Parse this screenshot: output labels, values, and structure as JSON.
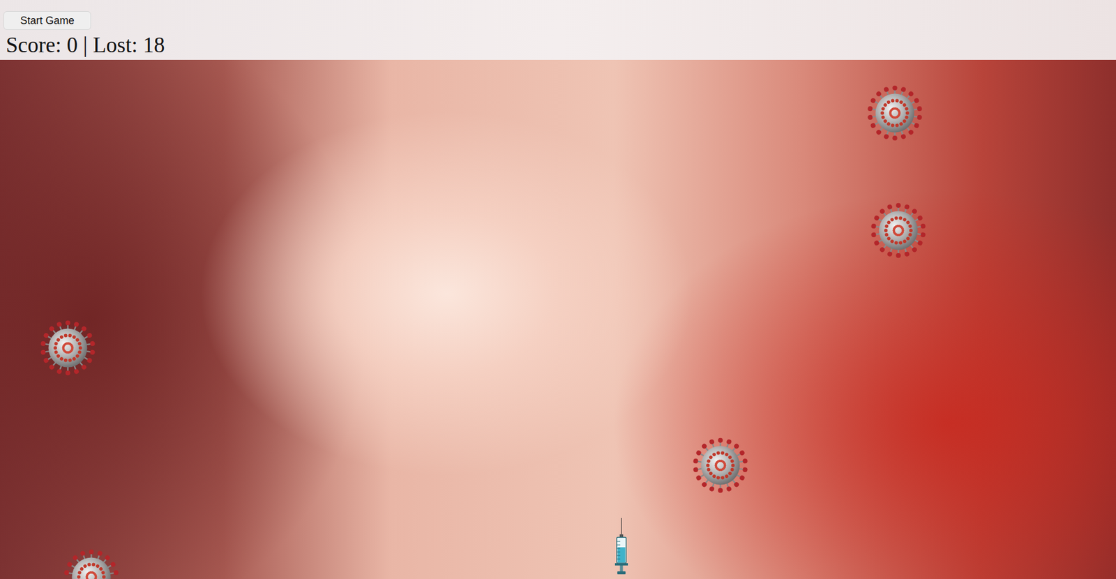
{
  "controls": {
    "start_button": {
      "label": "Start Game"
    }
  },
  "status": {
    "text": "Score: 0 | Lost: 18"
  }
}
